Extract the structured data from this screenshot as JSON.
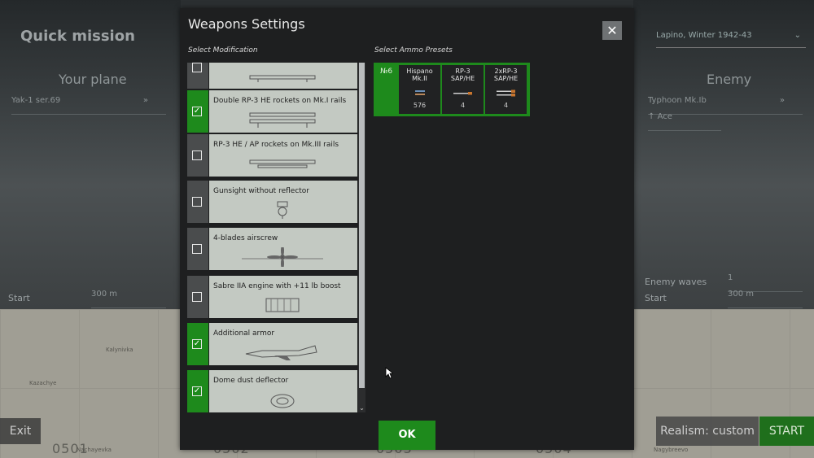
{
  "background": {
    "screen_title": "Quick mission",
    "your_plane_heading": "Your plane",
    "enemy_heading": "Enemy",
    "player_plane": "Yak-1 ser.69",
    "enemy_plane": "Typhoon Mk.Ib",
    "enemy_skill": "Ace",
    "location": "Lapino, Winter 1942-43",
    "start_label_left": "Start",
    "start_value_left": "300 m",
    "enemy_waves_label": "Enemy waves",
    "enemy_waves_value": "1",
    "start_label_right": "Start",
    "start_value_right": "300 m",
    "exit_label": "Exit",
    "realism_label": "Realism: custom",
    "start_button": "START",
    "map_numbers": [
      "0501",
      "0502",
      "0503",
      "0504"
    ],
    "map_places": [
      "Kalynivka",
      "Kazachye",
      "Nachayevka",
      "Nagybreevo"
    ]
  },
  "dialog": {
    "title": "Weapons Settings",
    "close_icon": "close-icon",
    "modification_label": "Select Modification",
    "ammo_label": "Select Ammo Presets",
    "ok_label": "OK",
    "modifications": [
      {
        "label": "",
        "checked": false,
        "icon": "rocket-rails-icon"
      },
      {
        "label": "Double RP-3 HE rockets on Mk.I rails",
        "checked": true,
        "icon": "rocket-rails-icon"
      },
      {
        "label": "RP-3 HE / AP rockets on Mk.III rails",
        "checked": false,
        "icon": "rocket-rails-icon"
      },
      {
        "label": "Gunsight without reflector",
        "checked": false,
        "icon": "gunsight-icon"
      },
      {
        "label": "4-blades airscrew",
        "checked": false,
        "icon": "propeller-icon"
      },
      {
        "label": "Sabre IIA engine with +11 lb boost",
        "checked": false,
        "icon": "engine-icon"
      },
      {
        "label": "Additional armor",
        "checked": true,
        "icon": "airplane-icon"
      },
      {
        "label": "Dome dust deflector",
        "checked": true,
        "icon": "dust-deflector-icon"
      }
    ],
    "ammo_preset": {
      "number": "№6",
      "slots": [
        {
          "name_line1": "Hispano",
          "name_line2": "Mk.II",
          "count": "576",
          "icon": "shells-icon"
        },
        {
          "name_line1": "RP-3",
          "name_line2": "SAP/HE",
          "count": "4",
          "icon": "rocket-icon"
        },
        {
          "name_line1": "2xRP-3",
          "name_line2": "SAP/HE",
          "count": "4",
          "icon": "rocket-pair-icon"
        }
      ]
    }
  },
  "colors": {
    "accent_green": "#1e8a1c",
    "dialog_bg": "#1e1f20",
    "item_bg": "#c3c9c2"
  }
}
